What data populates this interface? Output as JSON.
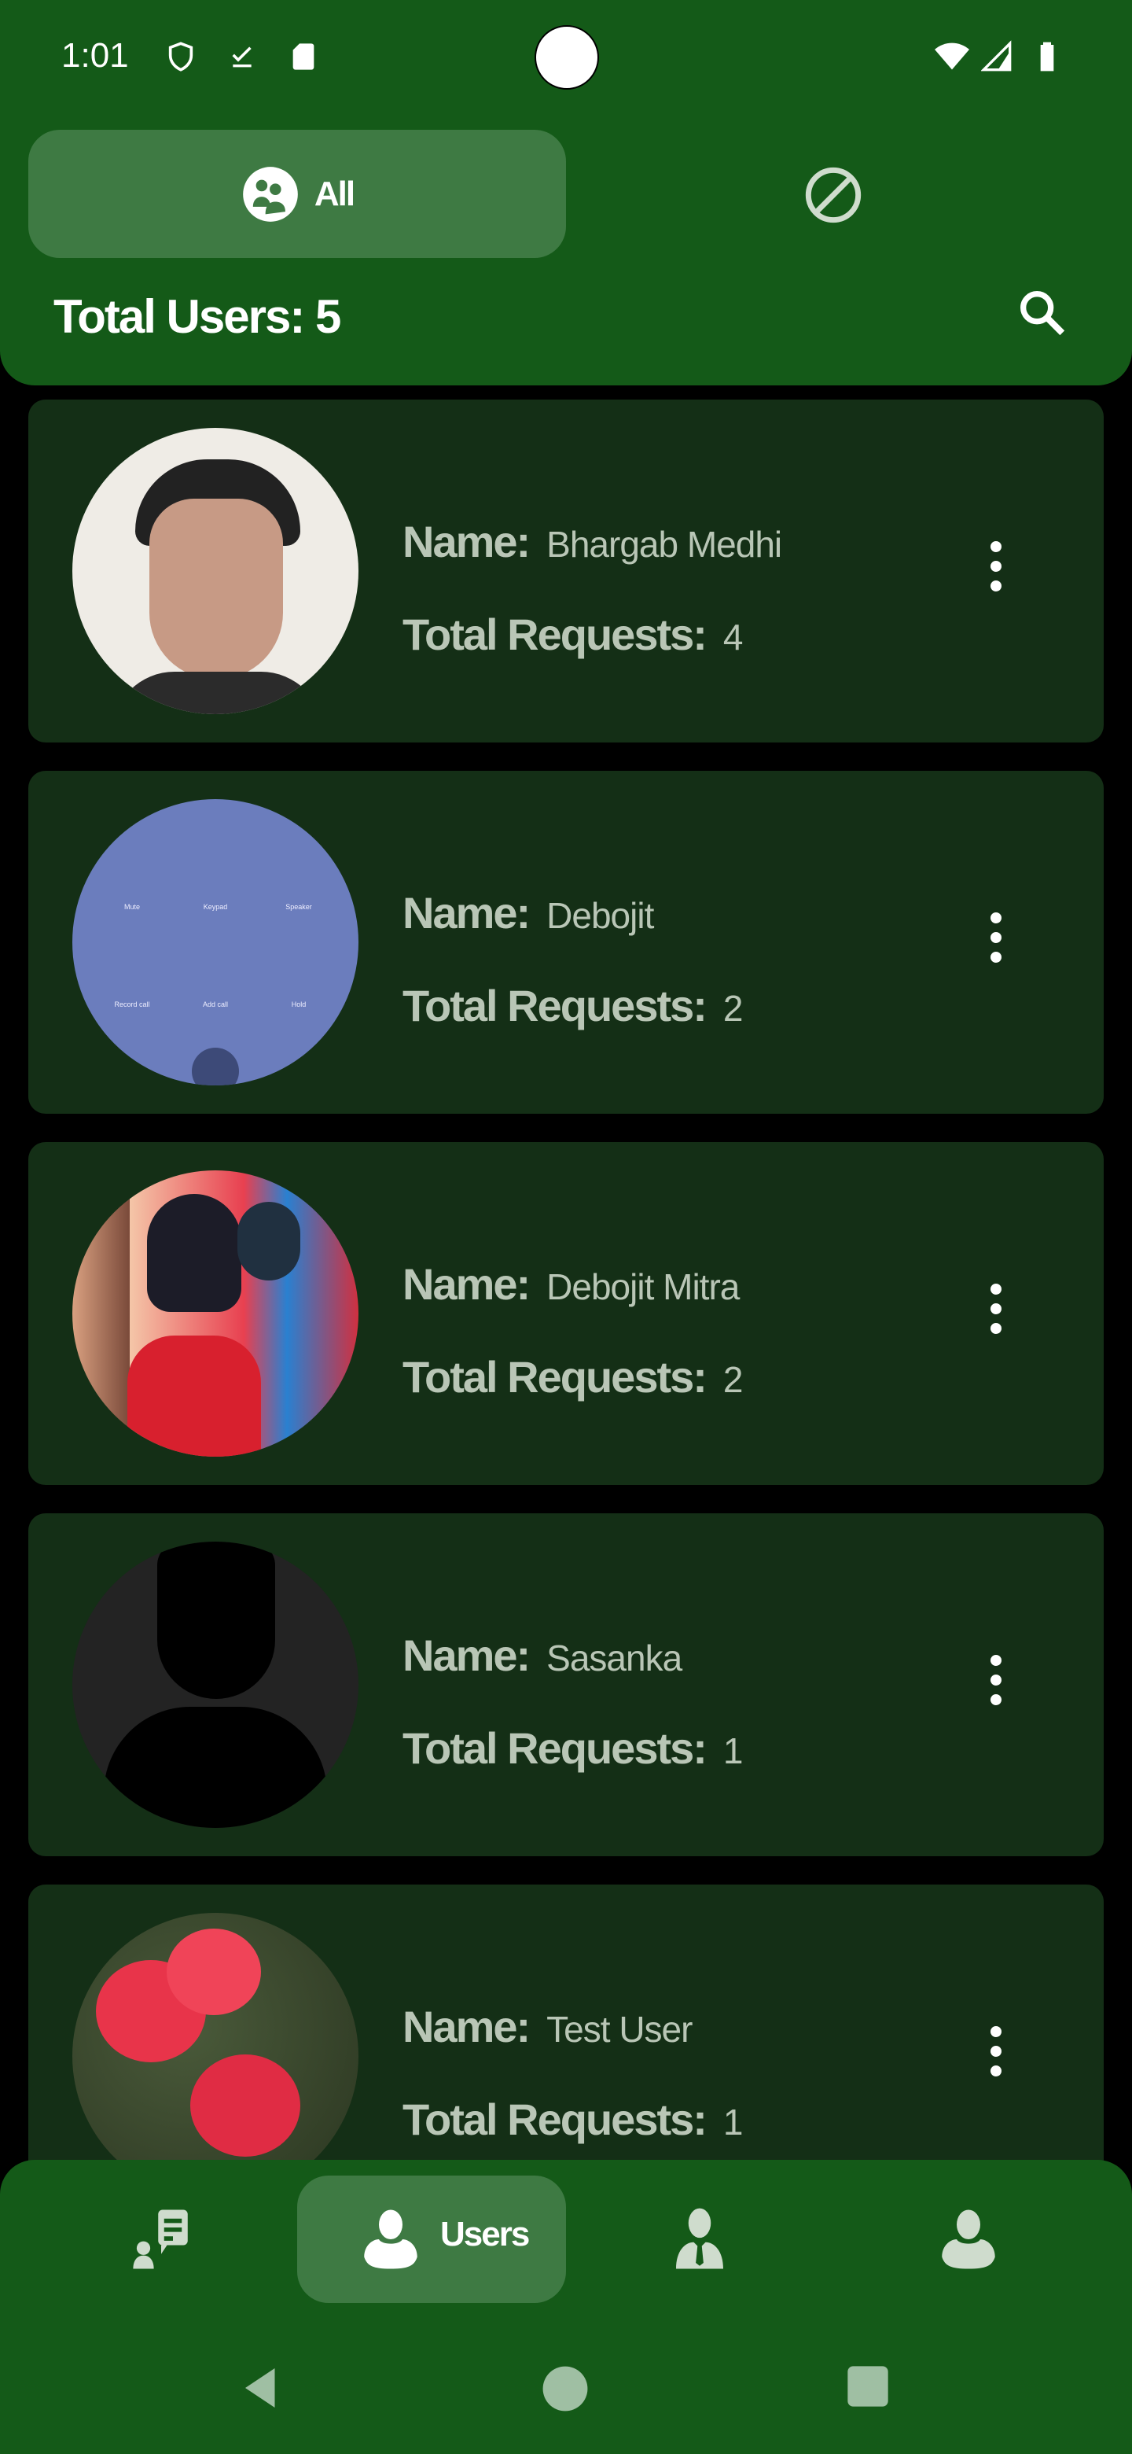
{
  "status_bar": {
    "time": "1:01",
    "icons": [
      "shield-icon",
      "download-done-icon",
      "sd-card-icon",
      "wifi-icon",
      "signal-icon",
      "battery-icon"
    ]
  },
  "header": {
    "tab_all_label": "All",
    "tab_blocked_icon": "block-icon",
    "total_users": "Total Users: 5",
    "search_icon": "search-icon"
  },
  "users": [
    {
      "name_label": "Name:",
      "name": "Bhargab Medhi",
      "requests_label": "Total Requests:",
      "requests": "4"
    },
    {
      "name_label": "Name:",
      "name": "Debojit",
      "requests_label": "Total Requests:",
      "requests": "2",
      "avatar_text": [
        "Mute",
        "Keypad",
        "Speaker",
        "Record call",
        "Add call",
        "Hold"
      ]
    },
    {
      "name_label": "Name:",
      "name": "Debojit Mitra",
      "requests_label": "Total Requests:",
      "requests": "2"
    },
    {
      "name_label": "Name:",
      "name": "Sasanka",
      "requests_label": "Total Requests:",
      "requests": "1"
    },
    {
      "name_label": "Name:",
      "name": "Test User",
      "requests_label": "Total Requests:",
      "requests": "1"
    }
  ],
  "bottom_nav": {
    "items": [
      {
        "icon": "chat-person-icon"
      },
      {
        "icon": "user-icon",
        "label": "Users"
      },
      {
        "icon": "business-person-icon"
      },
      {
        "icon": "profile-icon"
      }
    ]
  },
  "colors": {
    "header": "#145a18",
    "pill": "#3e7a43",
    "card": "#142f16",
    "label": "#b9c6b6"
  }
}
